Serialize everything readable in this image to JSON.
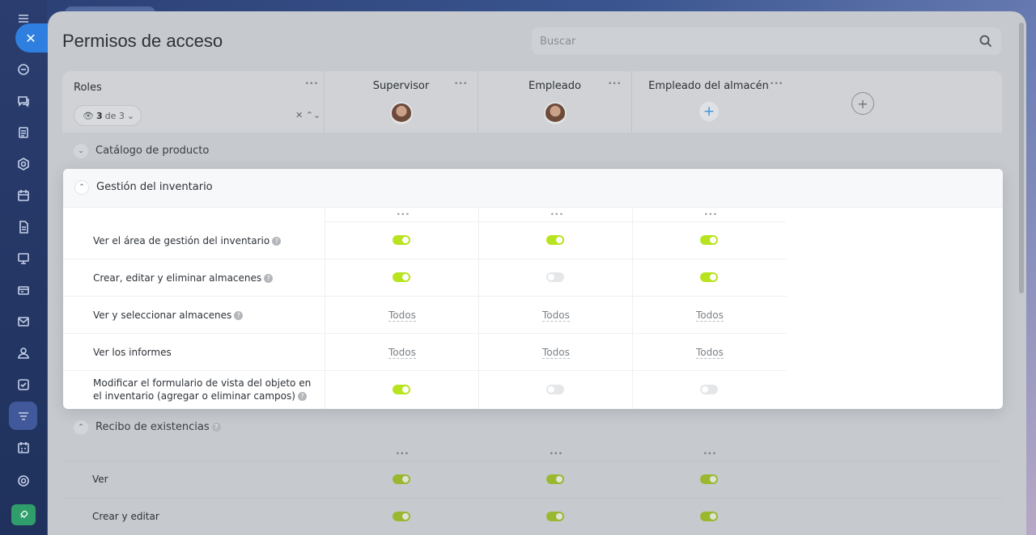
{
  "panel": {
    "title": "Permisos de acceso",
    "search_placeholder": "Buscar"
  },
  "roles_header": {
    "label": "Roles",
    "filter_count": "3",
    "filter_of": "de 3",
    "roles": [
      {
        "name": "Supervisor",
        "has_avatar": true
      },
      {
        "name": "Empleado",
        "has_avatar": true
      },
      {
        "name": "Empleado del almacén",
        "has_avatar": false
      }
    ]
  },
  "sections": {
    "catalog": {
      "label": "Catálogo de producto"
    },
    "inventory": {
      "label": "Gestión del inventario",
      "rows": [
        {
          "label": "Ver el área de gestión del inventario",
          "help": true,
          "values": [
            "on",
            "on",
            "on"
          ]
        },
        {
          "label": "Crear, editar y eliminar almacenes",
          "help": true,
          "values": [
            "on",
            "off",
            "on"
          ]
        },
        {
          "label": "Ver y seleccionar almacenes",
          "help": true,
          "values": [
            "Todos",
            "Todos",
            "Todos"
          ]
        },
        {
          "label": "Ver los informes",
          "help": false,
          "values": [
            "Todos",
            "Todos",
            "Todos"
          ]
        },
        {
          "label_line1": "Modificar el formulario de vista del objeto en",
          "label_line2": "el inventario (agregar o eliminar campos)",
          "help": true,
          "values": [
            "on",
            "off",
            "off"
          ]
        }
      ]
    },
    "receipt": {
      "label": "Recibo de existencias",
      "rows": [
        {
          "label": "Ver",
          "values": [
            "on",
            "on",
            "on"
          ]
        },
        {
          "label": "Crear y editar",
          "values": [
            "on",
            "on",
            "on"
          ]
        }
      ]
    }
  },
  "colors": {
    "accent_toggle": "#b8e31f",
    "close_button": "#2f7fe0"
  },
  "icons": {
    "close": "close-icon",
    "search": "search-icon",
    "add": "plus-icon",
    "more": "more-dots-icon"
  }
}
